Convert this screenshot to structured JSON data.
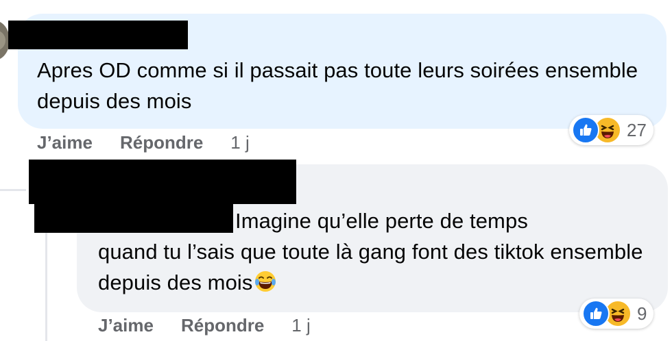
{
  "comments": [
    {
      "text": "Apres OD comme si il passait pas toute leurs soirées ensemble depuis des mois",
      "actions": {
        "like": "J’aime",
        "reply": "Répondre",
        "time": "1 j"
      },
      "reactions": {
        "icons": [
          "like-icon",
          "haha-icon"
        ],
        "count": "27"
      }
    },
    {
      "text_line1": "Imagine qu’elle perte de temps",
      "text_rest": "quand tu l’sais que toute là gang font des tiktok ensemble depuis des mois",
      "emoji": "face-with-tears-of-joy-icon",
      "actions": {
        "like": "J’aime",
        "reply": "Répondre",
        "time": "1 j"
      },
      "reactions": {
        "icons": [
          "like-icon",
          "haha-icon"
        ],
        "count": "9"
      }
    }
  ],
  "colors": {
    "bubble_own": "#e7f3ff",
    "bubble_reply": "#f0f2f5",
    "like_blue": "#1877f2",
    "haha_yellow": "#f7b928",
    "meta_gray": "#65676b"
  }
}
